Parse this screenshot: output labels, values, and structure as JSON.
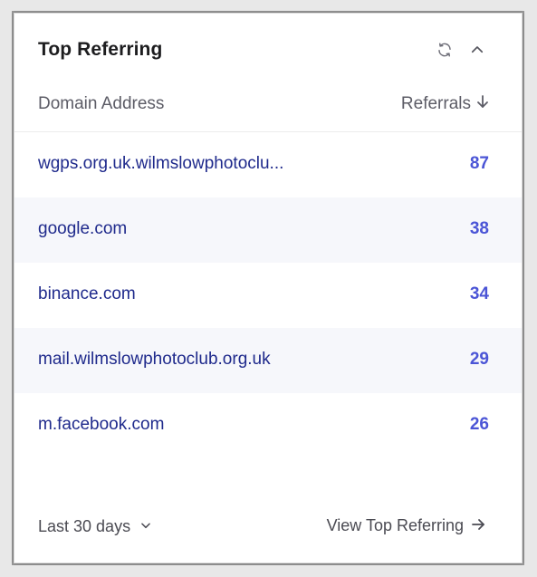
{
  "widget": {
    "title": "Top Referring",
    "refresh_icon": "refresh-icon",
    "collapse_icon": "chevron-up-icon"
  },
  "columns": {
    "domain": "Domain Address",
    "referrals": "Referrals",
    "sort_icon": "arrow-down-icon"
  },
  "rows": [
    {
      "domain": "wgps.org.uk.wilmslowphotoclu...",
      "count": "87"
    },
    {
      "domain": "google.com",
      "count": "38"
    },
    {
      "domain": "binance.com",
      "count": "34"
    },
    {
      "domain": "mail.wilmslowphotoclub.org.uk",
      "count": "29"
    },
    {
      "domain": "m.facebook.com",
      "count": "26"
    }
  ],
  "footer": {
    "range_label": "Last 30 days",
    "range_icon": "chevron-down-icon",
    "view_all_label": "View Top Referring",
    "view_all_icon": "arrow-right-icon"
  },
  "colors": {
    "domain_text": "#1f2a8c",
    "count_text": "#4b55d6",
    "alt_row_bg": "#f6f7fb"
  }
}
